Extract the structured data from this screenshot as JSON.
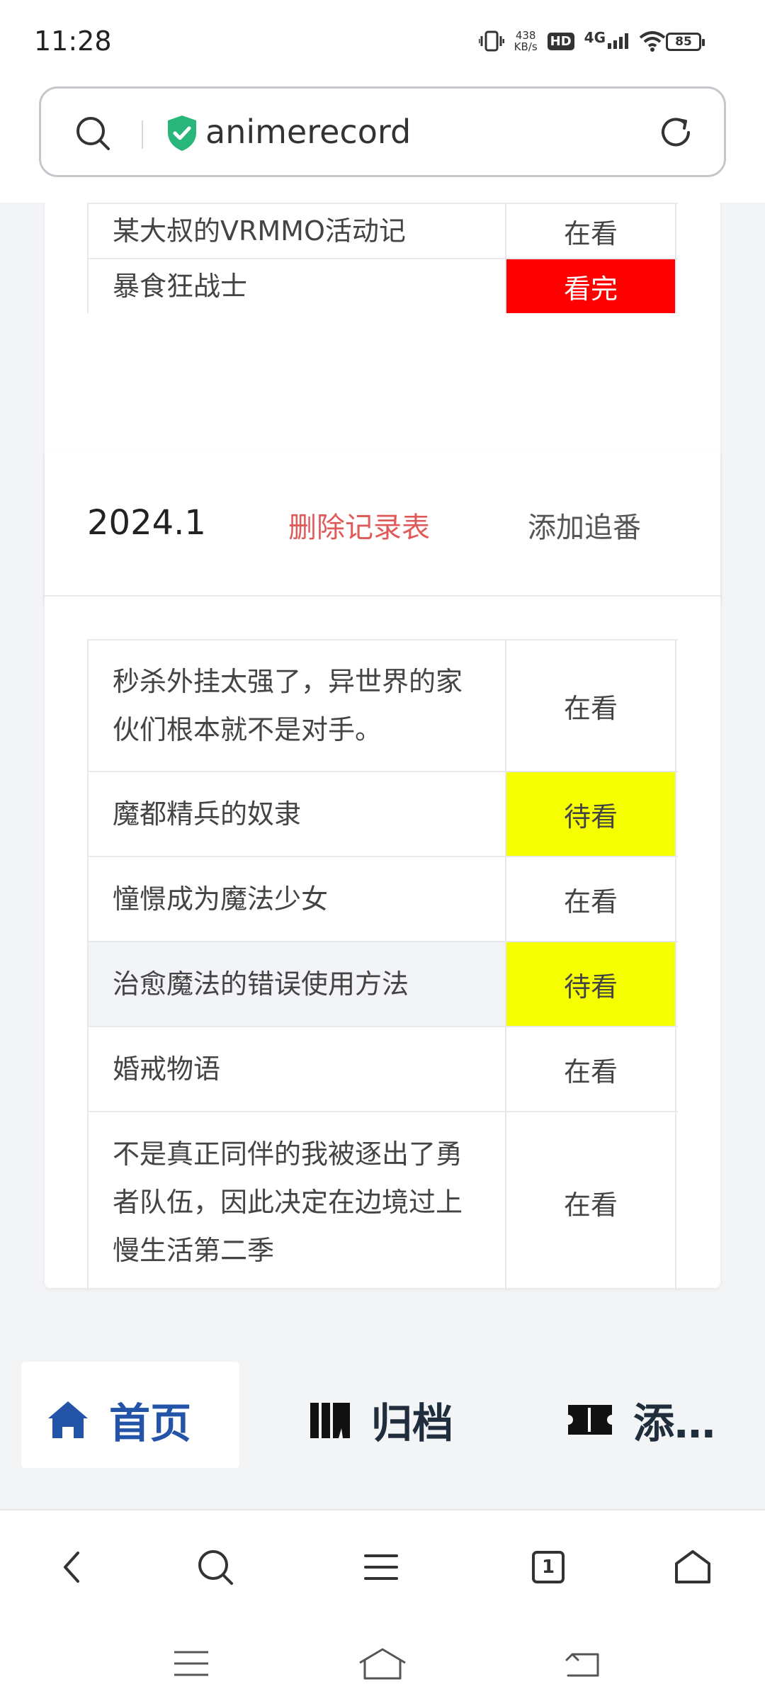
{
  "status_bar": {
    "time": "11:28",
    "net_speed_value": "438",
    "net_speed_unit": "KB/s",
    "hd_label": "HD",
    "network": "4G",
    "battery": "85"
  },
  "url_bar": {
    "url": "animerecord",
    "secure": true
  },
  "card_prev": {
    "rows": [
      {
        "name": "某大叔的VRMMO活动记",
        "status": "在看",
        "status_color": ""
      },
      {
        "name": "暴食狂战士",
        "status": "看完",
        "status_color": "#ff0000"
      }
    ]
  },
  "card_2024_1": {
    "date": "2024.1",
    "delete_label": "删除记录表",
    "add_label": "添加追番",
    "rows": [
      {
        "name": "秒杀外挂太强了，异世界的家伙们根本就不是对手。",
        "status": "在看",
        "status_color": ""
      },
      {
        "name": "魔都精兵的奴隶",
        "status": "待看",
        "status_color": "#f5ff00"
      },
      {
        "name": "憧憬成为魔法少女",
        "status": "在看",
        "status_color": ""
      },
      {
        "name": "治愈魔法的错误使用方法",
        "status": "待看",
        "status_color": "#f5ff00"
      },
      {
        "name": "婚戒物语",
        "status": "在看",
        "status_color": ""
      },
      {
        "name": "不是真正同伴的我被逐出了勇者队伍，因此决定在边境过上慢生活第二季",
        "status": "在看",
        "status_color": ""
      }
    ]
  },
  "site_nav": {
    "home": "首页",
    "archive": "归档",
    "add": "添…"
  },
  "browser_toolbar": {
    "tab_count": "1"
  },
  "colors": {
    "accent": "#2354a7",
    "danger_text": "#e15a5a",
    "status_done": "#ff0000",
    "status_pending": "#f5ff00"
  }
}
